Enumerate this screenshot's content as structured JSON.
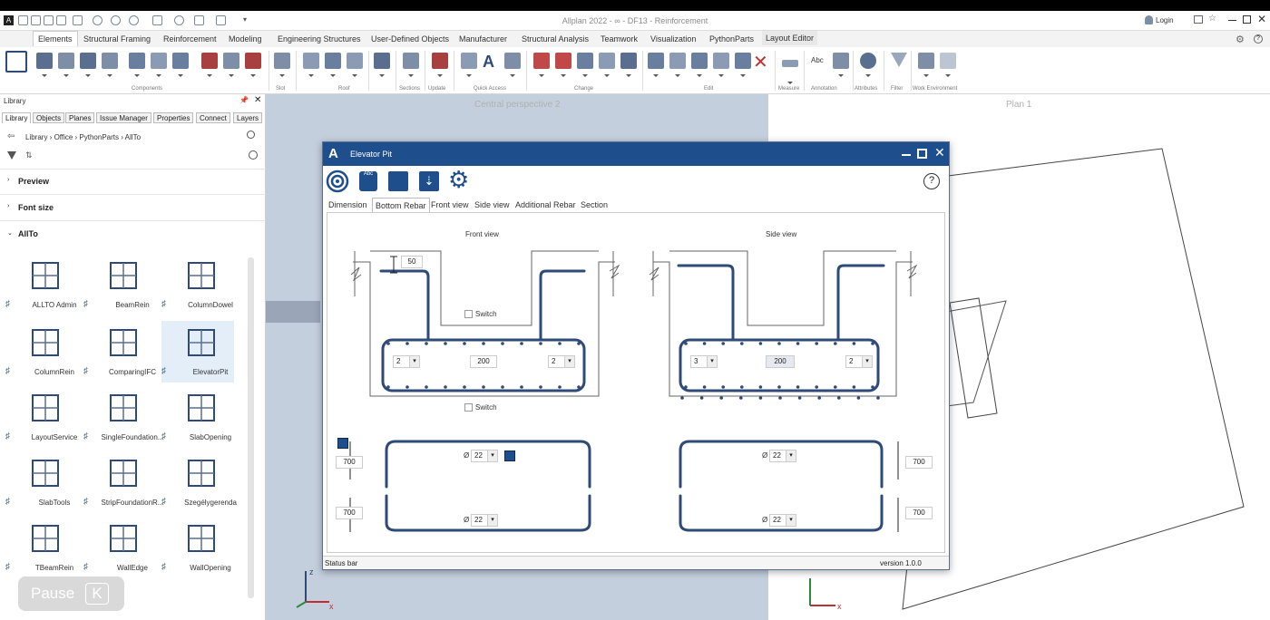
{
  "window": {
    "title": "Allplan 2022 - ∞ - DF13 - Reinforcement",
    "login_label": "Login"
  },
  "ribbon": {
    "tabs": [
      "Elements",
      "Structural Framing",
      "Reinforcement",
      "Modeling",
      "Engineering Structures",
      "User-Defined Objects",
      "Manufacturer",
      "Structural Analysis",
      "Teamwork",
      "Visualization",
      "PythonParts",
      "Layout Editor"
    ],
    "active_tab": "Elements",
    "groups": [
      "Components",
      "Slot",
      "Roof",
      "Sections",
      "Update",
      "Quick Access",
      "Change",
      "Edit",
      "Measure",
      "Annotation",
      "Attributes",
      "Filter",
      "Work Environment"
    ]
  },
  "library": {
    "title": "Library",
    "tabs": [
      "Library",
      "Objects",
      "Planes",
      "Issue Manager",
      "Properties",
      "Connect",
      "Layers"
    ],
    "active_tab": "Library",
    "breadcrumb": [
      "Library",
      "Office",
      "PythonParts",
      "AllTo"
    ],
    "sections": [
      "Preview",
      "Font size",
      "AllTo"
    ],
    "items": [
      {
        "label": "ALLTO Admin",
        "icon": "admin-gears-icon"
      },
      {
        "label": "BeamRein",
        "icon": "beam-icon"
      },
      {
        "label": "ColumnDowel",
        "icon": "column-dowel-icon"
      },
      {
        "label": "ColumnRein",
        "icon": "column-rein-icon"
      },
      {
        "label": "ComparingIFC",
        "icon": "compare-docs-icon"
      },
      {
        "label": "ElevatorPit",
        "icon": "elevator-pit-icon"
      },
      {
        "label": "LayoutService",
        "icon": "layout-service-icon"
      },
      {
        "label": "SingleFoundation...",
        "icon": "single-foundation-icon"
      },
      {
        "label": "SlabOpening",
        "icon": "slab-opening-icon"
      },
      {
        "label": "SlabTools",
        "icon": "slab-tools-icon"
      },
      {
        "label": "StripFoundationR...",
        "icon": "strip-foundation-icon"
      },
      {
        "label": "Szegélygerenda",
        "icon": "edge-beam-icon"
      },
      {
        "label": "TBeamRein",
        "icon": "tbeam-icon"
      },
      {
        "label": "WallEdge",
        "icon": "wall-edge-icon"
      },
      {
        "label": "WallOpening",
        "icon": "wall-opening-icon"
      }
    ],
    "selected_item": "ElevatorPit"
  },
  "viewports": {
    "left_label": "Central perspective 2",
    "right_label": "Plan 1"
  },
  "dialog": {
    "title": "Elevator Pit",
    "tabs": [
      "Dimension",
      "Bottom Rebar",
      "Front view",
      "Side view",
      "Additional Rebar",
      "Section"
    ],
    "active_tab": "Bottom Rebar",
    "front_view_label": "Front view",
    "side_view_label": "Side view",
    "front": {
      "top_offset": "50",
      "left_count": "2",
      "spacing": "200",
      "right_count": "2",
      "switch_label_1": "Switch",
      "switch_label_2": "Switch"
    },
    "side": {
      "left_count": "3",
      "spacing": "200",
      "right_count": "2"
    },
    "lower": {
      "front_upper_height": "700",
      "front_lower_height": "700",
      "front_dia_top_label": "Ø",
      "front_dia_top": "22",
      "front_dia_bottom_label": "Ø",
      "front_dia_bottom": "22",
      "side_dia_top_label": "Ø",
      "side_dia_top": "22",
      "side_dia_bottom_label": "Ø",
      "side_dia_bottom": "22",
      "side_upper_height": "700",
      "side_lower_height": "700"
    },
    "status_bar": "Status bar",
    "version": "version 1.0.0",
    "help_label": "?"
  },
  "overlay": {
    "pause_label": "Pause",
    "pause_key": "K"
  },
  "colors": {
    "accent": "#1e4e8c",
    "rebar": "#2e4a78",
    "viewport": "#c4cfdd"
  }
}
